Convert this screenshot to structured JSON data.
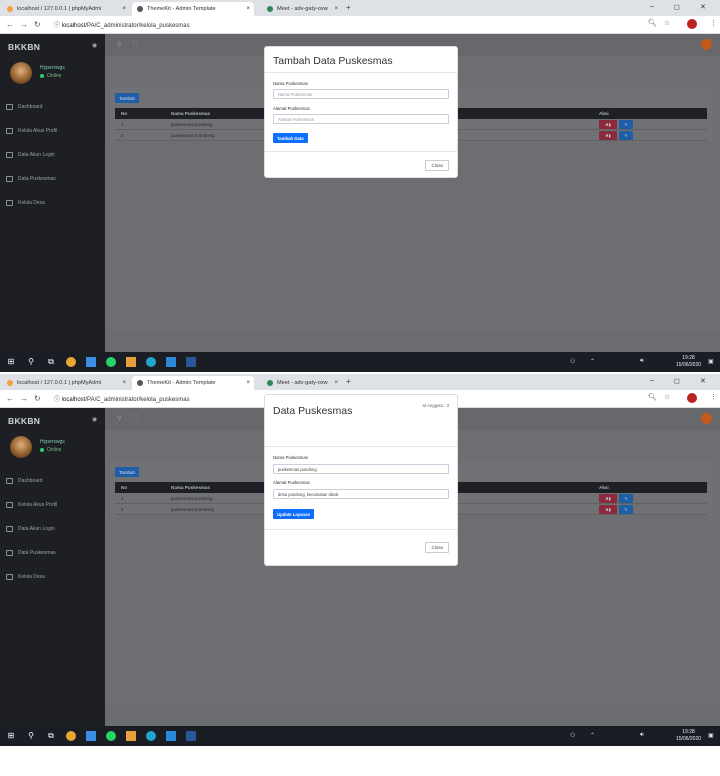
{
  "browser": {
    "tabs": [
      {
        "label": "localhost / 127.0.0.1 | phpMyAdmi",
        "icon": "phpmyadmin-icon"
      },
      {
        "label": "ThemeKit - Admin Template",
        "icon": "themekit-icon"
      },
      {
        "label": "Meet - adv-gaty-oxw",
        "icon": "meet-icon"
      }
    ],
    "address_host": "localhost",
    "address_path": "/PA/C_administrator/kelola_puskesmas"
  },
  "app": {
    "brand": "BKKBN",
    "profile_name": "Hyperxwgs",
    "profile_status": "Online",
    "menu": [
      "Dashboard",
      "Kelola Akun Profil",
      "Data Akun Login",
      "Data Puskesmas",
      "Kelola Desa"
    ]
  },
  "table": {
    "add_button": "Tambah",
    "headers": [
      "No",
      "Nama Puskesmas",
      "Aksi"
    ],
    "rows": [
      {
        "no": "1",
        "nama": "puskesmas pundong"
      },
      {
        "no": "2",
        "nama": "puskesmas kramberg"
      }
    ],
    "delete_label": "Hapus",
    "edit_label": "Edit"
  },
  "modal_add": {
    "title": "Tambah Data Puskesmas",
    "label_nama": "Nama Puskesmas",
    "placeholder_nama": "Nama Puskesmas",
    "label_alamat": "Alamat Puskesmas",
    "placeholder_alamat": "Alamat Puskesmas",
    "submit": "Tambah Data",
    "close": "Close"
  },
  "modal_edit": {
    "title": "Data Puskesmas",
    "id_label": "Id Anggota : 3",
    "label_nama": "Nama Puskesmas",
    "value_nama": "puskesmas pundong",
    "label_alamat": "Alamat Puskesmas",
    "value_alamat": "desa pundong, kecamatan dieok",
    "submit": "Update Layanan",
    "close": "Close"
  },
  "taskbar": {
    "time": "19:28",
    "date": "15/06/2020"
  },
  "colors": {
    "sidebar": "#1d1f24",
    "overlay": "#6d6f72",
    "primary": "#0d6efd",
    "danger": "#8a2a3c"
  }
}
